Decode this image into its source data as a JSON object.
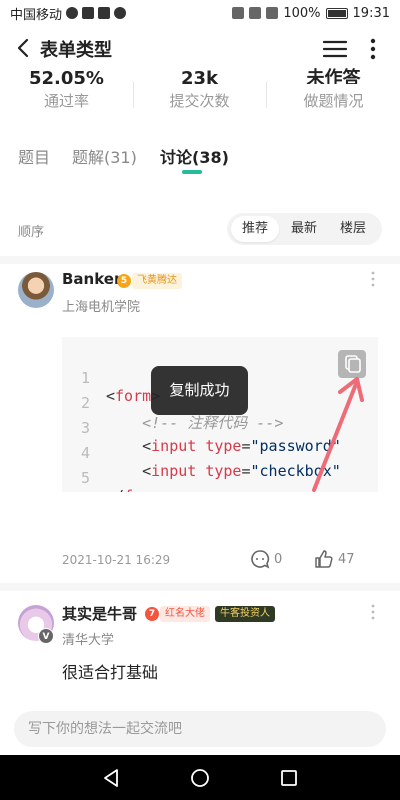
{
  "status_bar": {
    "carrier": "中国移动",
    "battery": "100%",
    "time": "19:31"
  },
  "header": {
    "title": "表单类型"
  },
  "stats": [
    {
      "value": "52.05%",
      "label": "通过率"
    },
    {
      "value": "23k",
      "label": "提交次数"
    },
    {
      "value": "未作答",
      "label": "做题情况"
    }
  ],
  "tabs": [
    {
      "label": "题目"
    },
    {
      "label": "题解(31)"
    },
    {
      "label": "讨论(38)"
    }
  ],
  "sort": {
    "label": "顺序",
    "options": [
      "推荐",
      "最新",
      "楼层"
    ]
  },
  "comment1": {
    "username": "Banker",
    "level": "5",
    "tag": "飞黄腾达",
    "school": "上海电机学院",
    "code_lines": [
      {
        "num": "1",
        "open": "<",
        "tag": "form",
        "close": ">"
      },
      {
        "num": "2",
        "comment": "<!-- 注释代码 -->"
      },
      {
        "num": "3",
        "indent": "    ",
        "open": "<",
        "tag": "input",
        "attr": "type",
        "eq": "=",
        "str": "\"password\""
      },
      {
        "num": "4",
        "indent": "    ",
        "open": "<",
        "tag": "input",
        "attr": "type",
        "eq": "=",
        "str": "\"checkbox\""
      },
      {
        "num": "5",
        "open": "</",
        "tag": "form",
        "close": ">"
      }
    ],
    "date": "2021-10-21 16:29",
    "comments": "0",
    "likes": "47"
  },
  "toast": "复制成功",
  "comment2": {
    "username": "其实是牛哥",
    "level": "7",
    "tag": "红名大佬",
    "tag2": "牛客投资人",
    "school": "清华大学",
    "verified": "V",
    "text": "很适合打基础"
  },
  "input": {
    "placeholder": "写下你的想法一起交流吧"
  },
  "colors": {
    "accent": "#25bb9b",
    "tag_gold": "#f6a51a",
    "tag_red": "#f5543e"
  }
}
